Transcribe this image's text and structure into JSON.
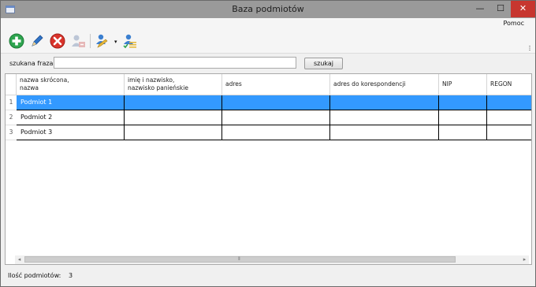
{
  "window": {
    "title": "Baza podmiotów"
  },
  "titlebar": {
    "min_glyph": "—",
    "max_glyph": "☐",
    "close_glyph": "✕"
  },
  "menu": {
    "help": "Pomoc"
  },
  "toolbar": {
    "icons": [
      "add-icon",
      "edit-icon",
      "delete-icon",
      "user-add-disabled-icon",
      "users-dropdown-icon",
      "user-list-icon"
    ],
    "dropdown_glyph": "▾"
  },
  "search": {
    "label": "szukana fraza",
    "value": "",
    "button_label": "szukaj"
  },
  "grid": {
    "columns": [
      {
        "label1": "nazwa skrócona,",
        "label2": "nazwa"
      },
      {
        "label1": "imię i nazwisko,",
        "label2": "nazwisko panieńskie"
      },
      {
        "label1": "adres",
        "label2": ""
      },
      {
        "label1": "adres do korespondencji",
        "label2": ""
      },
      {
        "label1": "NIP",
        "label2": ""
      },
      {
        "label1": "REGON",
        "label2": ""
      }
    ],
    "rows": [
      {
        "index": "1",
        "cells": [
          "Podmiot 1",
          "",
          "",
          "",
          "",
          ""
        ],
        "selected": true
      },
      {
        "index": "2",
        "cells": [
          "Podmiot 2",
          "",
          "",
          "",
          "",
          ""
        ],
        "selected": false
      },
      {
        "index": "3",
        "cells": [
          "Podmiot 3",
          "",
          "",
          "",
          "",
          ""
        ],
        "selected": false
      }
    ]
  },
  "scrollbar": {
    "left_glyph": "◂",
    "right_glyph": "▸",
    "grip_glyph": "⦀"
  },
  "status": {
    "label": "Ilość podmiotów:",
    "count": "3"
  },
  "colors": {
    "selection": "#3399ff",
    "add": "#2ea44f",
    "delete": "#d9332b",
    "edit": "#2f74c8",
    "close": "#c7362f"
  }
}
